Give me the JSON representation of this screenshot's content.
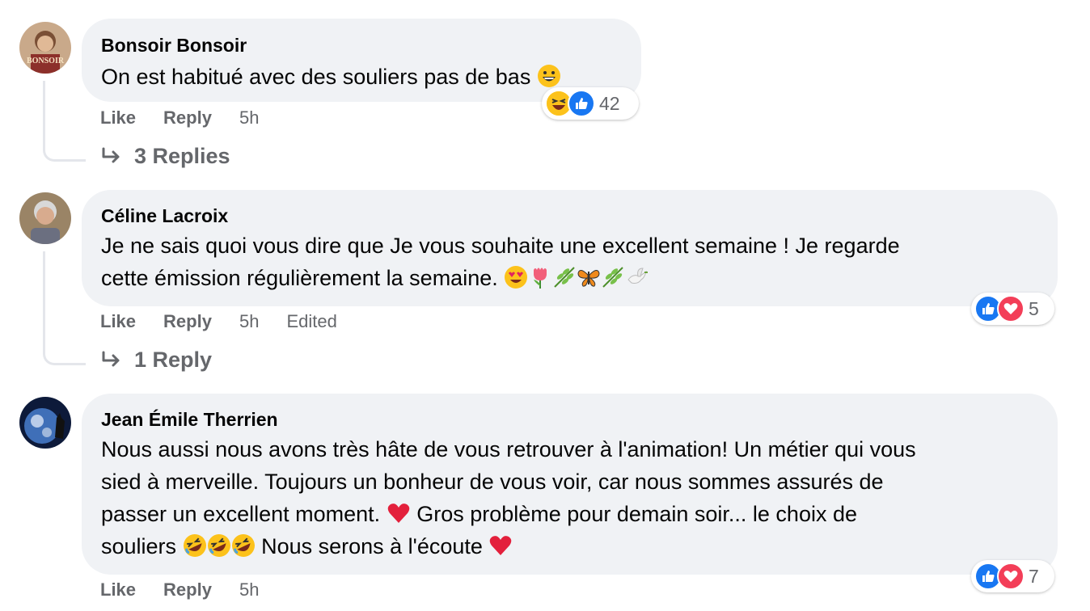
{
  "comments": [
    {
      "author": "Bonsoir Bonsoir",
      "avatar_text": "BONSOIR",
      "lines": [
        "On est habitué avec des souliers pas de bas"
      ],
      "actions": {
        "like": "Like",
        "reply": "Reply",
        "time": "5h",
        "edited": ""
      },
      "reactions": {
        "icons": [
          "haha-icon",
          "like-icon"
        ],
        "count": "42"
      },
      "replies_label": "3 Replies"
    },
    {
      "author": "Céline Lacroix",
      "lines": [
        "Je ne sais quoi vous dire que Je vous souhaite une excellent semaine ! Je regarde",
        "cette émission régulièrement la semaine."
      ],
      "actions": {
        "like": "Like",
        "reply": "Reply",
        "time": "5h",
        "edited": "Edited"
      },
      "reactions": {
        "icons": [
          "like-icon",
          "love-icon"
        ],
        "count": "5"
      },
      "replies_label": "1 Reply"
    },
    {
      "author": "Jean Émile Therrien",
      "lines": [
        "Nous aussi nous avons très hâte de vous retrouver à l'animation! Un métier qui vous",
        "sied à merveille. Toujours un bonheur de vous voir, car nous sommes assurés de",
        "passer un excellent moment.",
        "Gros problème pour demain soir... le choix de",
        "souliers",
        "Nous serons à l'écoute"
      ],
      "actions": {
        "like": "Like",
        "reply": "Reply",
        "time": "5h"
      },
      "reactions": {
        "icons": [
          "like-icon",
          "love-icon"
        ],
        "count": "7"
      }
    }
  ],
  "colors": {
    "bubble": "#f0f2f5",
    "meta": "#65676b",
    "like_blue": "#1877f2",
    "love_red": "#f33e58",
    "haha_yellow": "#fcd34d"
  }
}
